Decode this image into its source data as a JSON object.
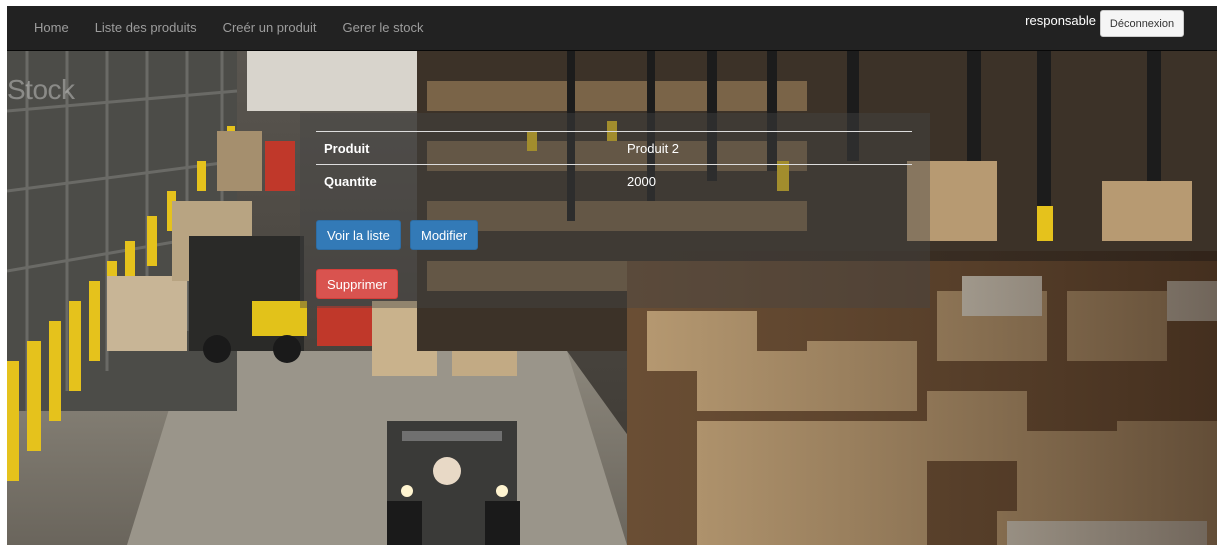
{
  "navbar": {
    "links": [
      "Home",
      "Liste des produits",
      "Creér un produit",
      "Gerer le stock"
    ],
    "user": "responsable",
    "logout_label": "Déconnexion"
  },
  "page": {
    "title": "Stock"
  },
  "detail": {
    "rows": [
      {
        "label": "Produit",
        "value": "Produit 2"
      },
      {
        "label": "Quantite",
        "value": "2000"
      }
    ]
  },
  "actions": {
    "list_label": "Voir la liste",
    "edit_label": "Modifier",
    "delete_label": "Supprimer"
  },
  "colors": {
    "navbar": "#222222",
    "primary": "#337ab7",
    "danger": "#d9534f"
  }
}
